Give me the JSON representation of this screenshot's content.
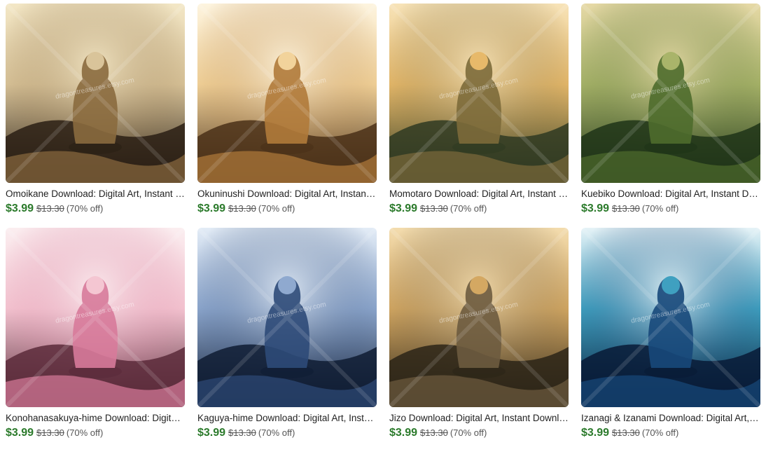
{
  "listings": [
    {
      "title": "Omoikane Download: Digital Art, Instant Download",
      "price": "$3.99",
      "original_price": "$13.30",
      "discount": "(70% off)",
      "watermark": "dragontreasures.etsy.com",
      "image_alt": "Omoikane",
      "palette": [
        "#2a1f14",
        "#8a6a3e",
        "#d9c49a",
        "#f3e7c6"
      ]
    },
    {
      "title": "Okuninushi Download: Digital Art, Instant Download",
      "price": "$3.99",
      "original_price": "$13.30",
      "discount": "(70% off)",
      "watermark": "dragontreasures.etsy.com",
      "image_alt": "Okuninushi",
      "palette": [
        "#4a3018",
        "#b07a3a",
        "#f2d39b",
        "#fdf4df"
      ]
    },
    {
      "title": "Momotaro Download: Digital Art, Instant Download",
      "price": "$3.99",
      "original_price": "$13.30",
      "discount": "(70% off)",
      "watermark": "dragontreasures.etsy.com",
      "image_alt": "Momotaro",
      "palette": [
        "#2f3a22",
        "#7c6a3a",
        "#e7b96a",
        "#f7e3b8"
      ]
    },
    {
      "title": "Kuebiko Download: Digital Art, Instant Download",
      "price": "$3.99",
      "original_price": "$13.30",
      "discount": "(70% off)",
      "watermark": "dragontreasures.etsy.com",
      "image_alt": "Kuebiko",
      "palette": [
        "#1e3418",
        "#4e6b2c",
        "#a9b46a",
        "#e6d9a6"
      ]
    },
    {
      "title": "Konohanasakuya-hime Download: Digital Art, Instant Download",
      "price": "$3.99",
      "original_price": "$13.30",
      "discount": "(70% off)",
      "watermark": "dragontreasures.etsy.com",
      "image_alt": "Konohanasakuya-hime",
      "palette": [
        "#5a2a3a",
        "#d77a9a",
        "#f4c6d2",
        "#fbeef0"
      ]
    },
    {
      "title": "Kaguya-hime Download: Digital Art, Instant Download",
      "price": "$3.99",
      "original_price": "$13.30",
      "discount": "(70% off)",
      "watermark": "dragontreasures.etsy.com",
      "image_alt": "Kaguya-hime",
      "palette": [
        "#0f1c33",
        "#2e4a78",
        "#8fa9cf",
        "#e3ecf6"
      ]
    },
    {
      "title": "Jizo Download: Digital Art, Instant Download",
      "price": "$3.99",
      "original_price": "$13.30",
      "discount": "(70% off)",
      "watermark": "dragontreasures.etsy.com",
      "image_alt": "Jizo",
      "palette": [
        "#2b2418",
        "#6d5b3f",
        "#d4a862",
        "#f3dcae"
      ]
    },
    {
      "title": "Izanagi & Izanami Download: Digital Art, Instant Download",
      "price": "$3.99",
      "original_price": "$13.30",
      "discount": "(70% off)",
      "watermark": "dragontreasures.etsy.com",
      "image_alt": "Izanagi & Izanami",
      "palette": [
        "#081a36",
        "#17487a",
        "#3fa0c0",
        "#e6f3f7"
      ]
    }
  ]
}
